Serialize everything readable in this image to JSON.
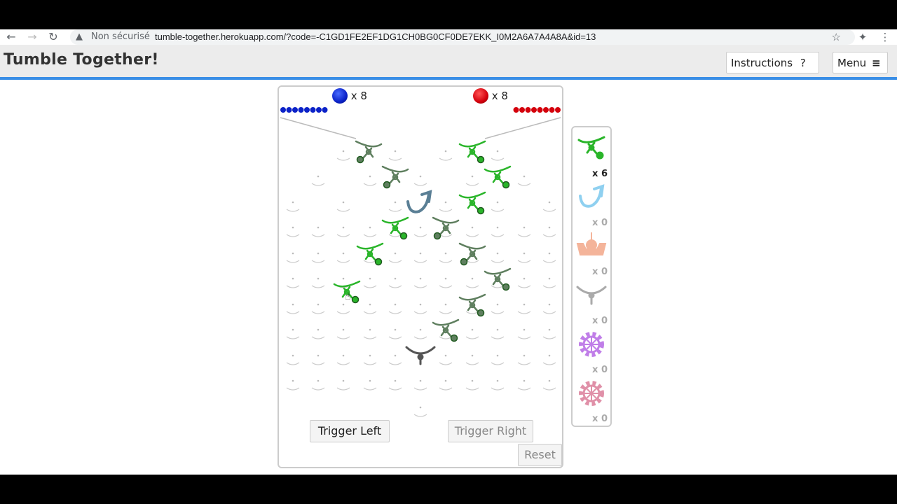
{
  "browser": {
    "warning_icon": "warning-triangle-icon",
    "security_text": "Non sécurisé",
    "url": "tumble-together.herokuapp.com/?code=-C1GD1FE2EF1DG1CH0BG0CF0DE7EKK_I0M2A6A7A4A8A&id=13"
  },
  "app": {
    "title": "Tumble Together!",
    "instructions_label": "Instructions",
    "instructions_icon": "?",
    "menu_label": "Menu",
    "menu_icon": "≡"
  },
  "board": {
    "blue_count": "x 8",
    "red_count": "x 8",
    "blue_color": "#0b22c8",
    "red_color": "#d4000c",
    "trigger_left": "Trigger Left",
    "trigger_right": "Trigger Right",
    "reset": "Reset"
  },
  "parts_panel": {
    "items": [
      {
        "name": "ramp",
        "count": "x 6",
        "color": "#2ab52a"
      },
      {
        "name": "crossover",
        "count": "x 0",
        "color": "#8fd0f0"
      },
      {
        "name": "interceptor",
        "count": "x 0",
        "color": "#f4b49a"
      },
      {
        "name": "bit",
        "count": "x 0",
        "color": "#aaaaaa"
      },
      {
        "name": "gear",
        "count": "x 0",
        "color": "#c07ee8"
      },
      {
        "name": "gear-bit",
        "count": "x 0",
        "color": "#e090a8"
      }
    ]
  }
}
